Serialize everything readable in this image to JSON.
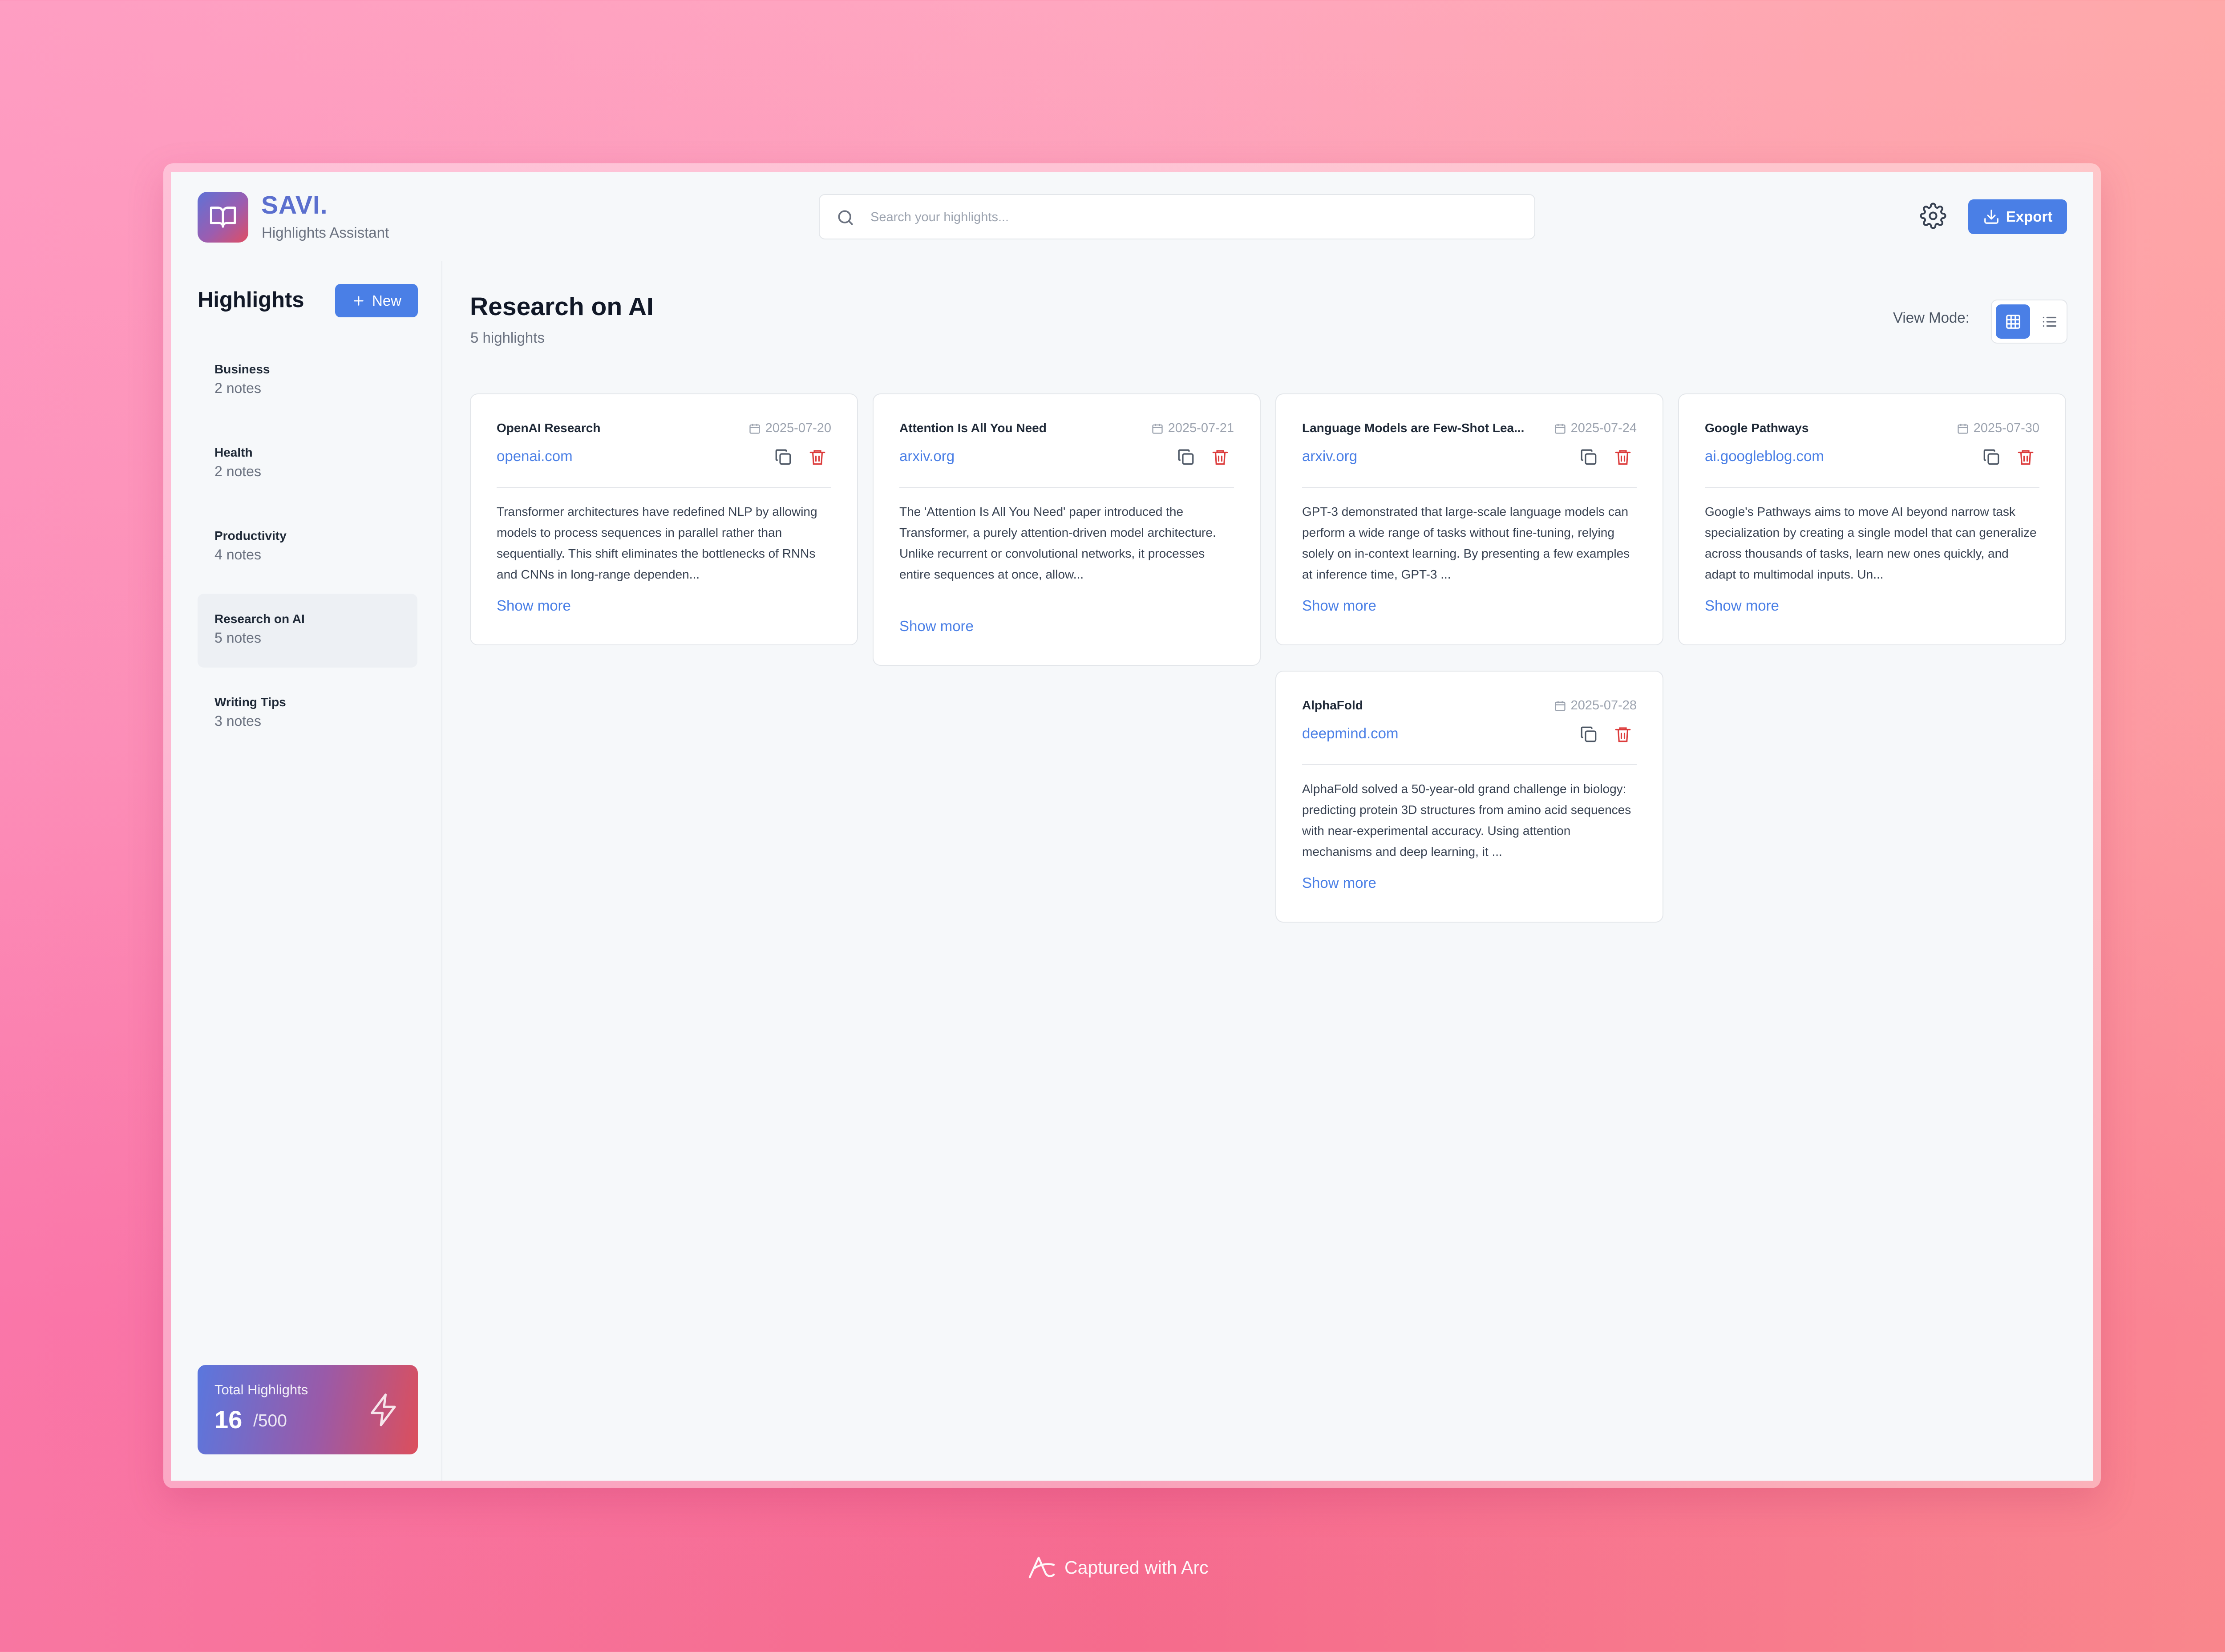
{
  "brand": {
    "name": "SAVI.",
    "subtitle": "Highlights Assistant"
  },
  "search": {
    "placeholder": "Search your highlights..."
  },
  "header": {
    "export_label": "Export"
  },
  "sidebar": {
    "title": "Highlights",
    "new_label": "New",
    "categories": [
      {
        "name": "Business",
        "count": "2 notes"
      },
      {
        "name": "Health",
        "count": "2 notes"
      },
      {
        "name": "Productivity",
        "count": "4 notes"
      },
      {
        "name": "Research on AI",
        "count": "5 notes"
      },
      {
        "name": "Writing Tips",
        "count": "3 notes"
      }
    ],
    "active_category": "Research on AI",
    "total": {
      "label": "Total Highlights",
      "value": "16",
      "max": "/500"
    }
  },
  "main": {
    "title": "Research on AI",
    "count": "5 highlights",
    "view_mode_label": "View Mode:",
    "view_mode_selected": "grid",
    "show_more_label": "Show more",
    "cards": [
      {
        "title": "OpenAI Research",
        "date": "2025-07-20",
        "domain": "openai.com",
        "text": "Transformer architectures have redefined NLP by allowing models to process sequences in parallel rather than sequentially. This shift eliminates the bottlenecks of RNNs and CNNs in long-range dependen..."
      },
      {
        "title": "Attention Is All You Need",
        "date": "2025-07-21",
        "domain": "arxiv.org",
        "text": "The 'Attention Is All You Need' paper introduced the Transformer, a purely attention-driven model architecture. Unlike recurrent or convolutional networks, it processes entire sequences at once, allow..."
      },
      {
        "title": "Language Models are Few-Shot Lea...",
        "date": "2025-07-24",
        "domain": "arxiv.org",
        "text": "GPT-3 demonstrated that large-scale language models can perform a wide range of tasks without fine-tuning, relying solely on in-context learning. By presenting a few examples at inference time, GPT-3 ..."
      },
      {
        "title": "Google Pathways",
        "date": "2025-07-30",
        "domain": "ai.googleblog.com",
        "text": "Google's Pathways aims to move AI beyond narrow task specialization by creating a single model that can generalize across thousands of tasks, learn new ones quickly, and adapt to multimodal inputs. Un..."
      },
      {
        "title": "AlphaFold",
        "date": "2025-07-28",
        "domain": "deepmind.com",
        "text": "AlphaFold solved a 50-year-old grand challenge in biology: predicting protein 3D structures from amino acid sequences with near-experimental accuracy. Using attention mechanisms and deep learning, it ..."
      }
    ]
  },
  "footer": {
    "capture_label": "Captured with Arc"
  },
  "colors": {
    "accent": "#4a7fe6",
    "brand": "#5b6fce",
    "danger": "#dc3b3b"
  }
}
